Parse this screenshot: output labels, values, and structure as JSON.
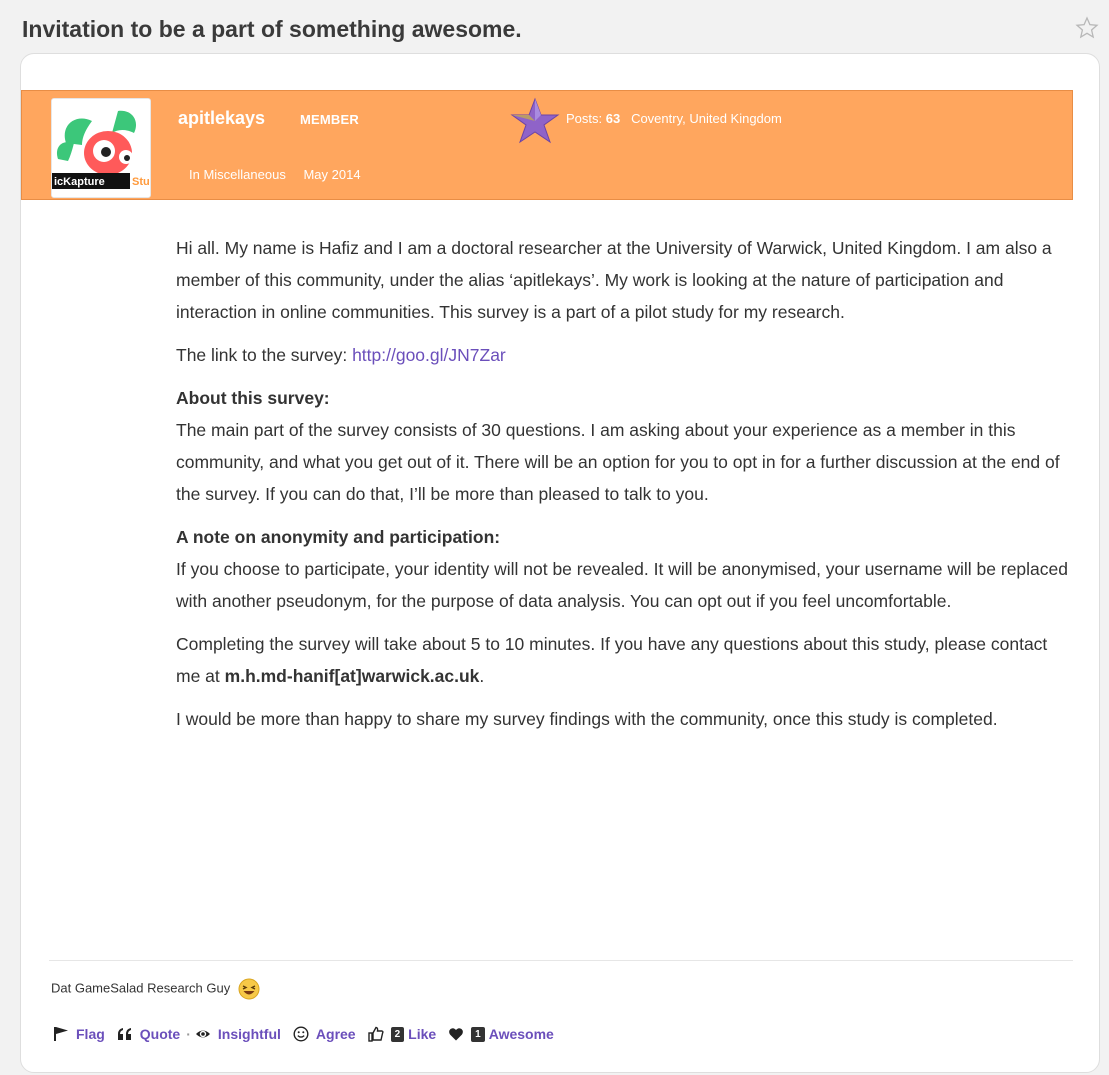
{
  "thread": {
    "title": "Invitation to be a part of something awesome."
  },
  "post": {
    "author": {
      "name": "apitlekays",
      "role": "MEMBER",
      "posts_label": "Posts:",
      "posts_count": "63",
      "location": "Coventry, United Kingdom",
      "avatar_text_a": "icKapture",
      "avatar_text_b": "Stu"
    },
    "meta": {
      "category": "In Miscellaneous",
      "date": "May 2014"
    },
    "body": {
      "p1": "Hi all. My name is Hafiz and I am a doctoral researcher at the University of Warwick, United Kingdom. I am also a member of this community, under the alias ‘apitlekays’. My work is looking at the nature of participation and interaction in online communities. This survey is a part of a pilot study for my research.",
      "link_label": "The link to the survey: ",
      "link_url": "http://goo.gl/JN7Zar",
      "about_heading": "About this survey:",
      "about_text": "The main part of the survey consists of 30 questions. I am asking about your experience as a member in this community, and what you get out of it. There will be an option for you to opt in for a further discussion at the end of the survey. If you can do that, I’ll be more than pleased to talk to you.",
      "anon_heading": "A note on anonymity and participation:",
      "anon_text": "If you choose to participate, your identity will not be revealed. It will be anonymised, your username will be replaced with another pseudonym, for the purpose of data analysis. You can opt out if you feel uncomfortable.",
      "complete_text": "Completing the survey will take about 5 to 10 minutes. If you have any questions about this study, please contact me at ",
      "email": "m.h.md-hanif[at]warwick.ac.uk",
      "complete_end": ".",
      "closing": "I would be more than happy to share my survey findings with the community, once this study is completed."
    },
    "signature": "Dat GameSalad Research Guy",
    "reactions": {
      "flag": "Flag",
      "quote": "Quote",
      "dot": "·",
      "insightful": "Insightful",
      "agree": "Agree",
      "like_count": "2",
      "like": "Like",
      "awesome_count": "1",
      "awesome": "Awesome"
    }
  },
  "colors": {
    "author_bar": "#ffa65e",
    "link": "#6b4fbb"
  }
}
